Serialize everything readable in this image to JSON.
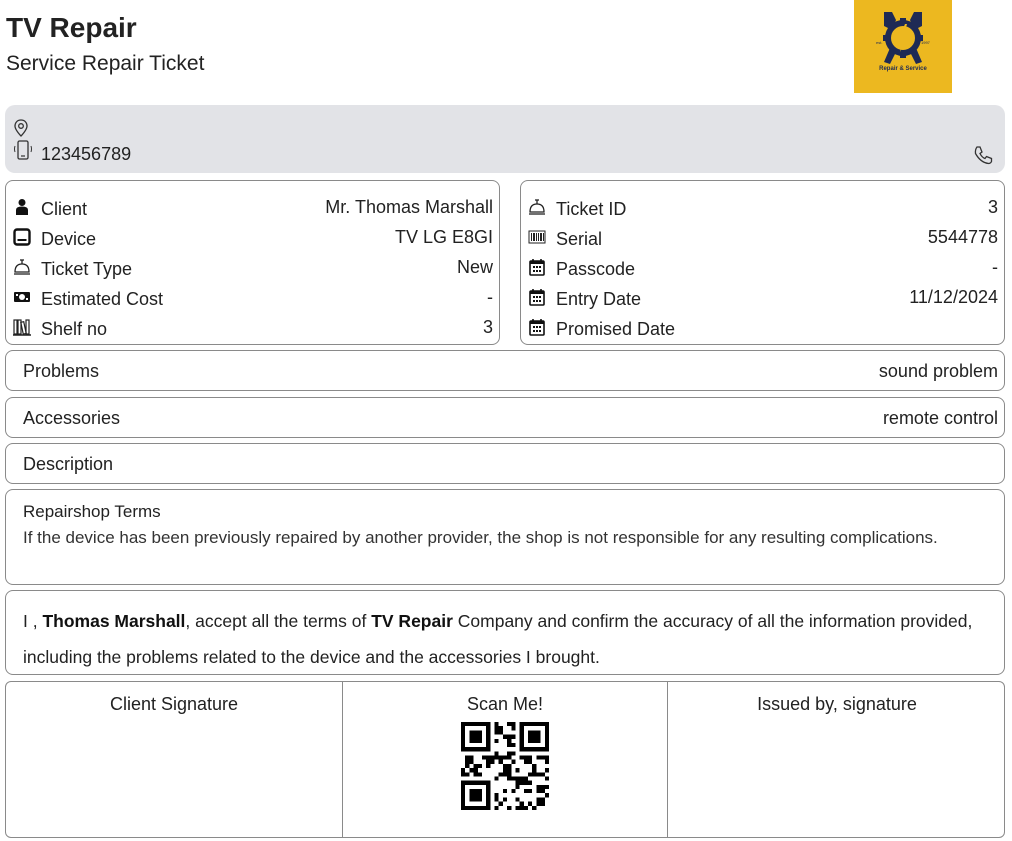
{
  "header": {
    "title": "TV Repair",
    "subtitle": "Service Repair Ticket",
    "logo_text": "Repair & Service",
    "logo_year_left": "est.",
    "logo_year_right": "1997"
  },
  "contact": {
    "phone": "123456789",
    "icons": [
      "map-pin-icon",
      "mobile-phone-icon",
      "phone-icon"
    ]
  },
  "client_info": [
    {
      "icon": "person-icon",
      "label": "Client",
      "value": "Mr. Thomas Marshall"
    },
    {
      "icon": "tablet-icon",
      "label": "Device",
      "value": "TV LG E8GI"
    },
    {
      "icon": "service-bell-icon",
      "label": "Ticket Type",
      "value": "New"
    },
    {
      "icon": "money-icon",
      "label": "Estimated Cost",
      "value": "-"
    },
    {
      "icon": "shelf-icon",
      "label": "Shelf no",
      "value": "3"
    }
  ],
  "ticket_info": [
    {
      "icon": "service-bell-icon",
      "label": "Ticket ID",
      "value": "3"
    },
    {
      "icon": "barcode-icon",
      "label": "Serial",
      "value": "5544778"
    },
    {
      "icon": "calendar-icon",
      "label": "Passcode",
      "value": "-"
    },
    {
      "icon": "calendar-icon",
      "label": "Entry Date",
      "value": "11/12/2024"
    },
    {
      "icon": "calendar-icon",
      "label": "Promised Date",
      "value": ""
    }
  ],
  "problems": {
    "label": "Problems",
    "value": "sound problem"
  },
  "accessories": {
    "label": "Accessories",
    "value": "remote control"
  },
  "description": {
    "label": "Description",
    "value": ""
  },
  "terms": {
    "title": "Repairshop Terms",
    "body": "If the device has been previously repaired by another provider, the shop is not responsible for any resulting complications."
  },
  "acceptance": {
    "prefix": "I , ",
    "client_name": "Thomas Marshall",
    "middle": ", accept all the terms of ",
    "company": "TV Repair",
    "suffix": " Company and confirm the accuracy of all the information provided, including the problems related to the device and the accessories I brought."
  },
  "signatures": {
    "client_label": "Client Signature",
    "scan_label": "Scan Me!",
    "issued_label": "Issued by, signature"
  },
  "colors": {
    "logo_bg": "#ecb820",
    "logo_fg": "#1e2a55",
    "contact_bg": "#e2e3e7",
    "border": "#8a8a8a"
  }
}
